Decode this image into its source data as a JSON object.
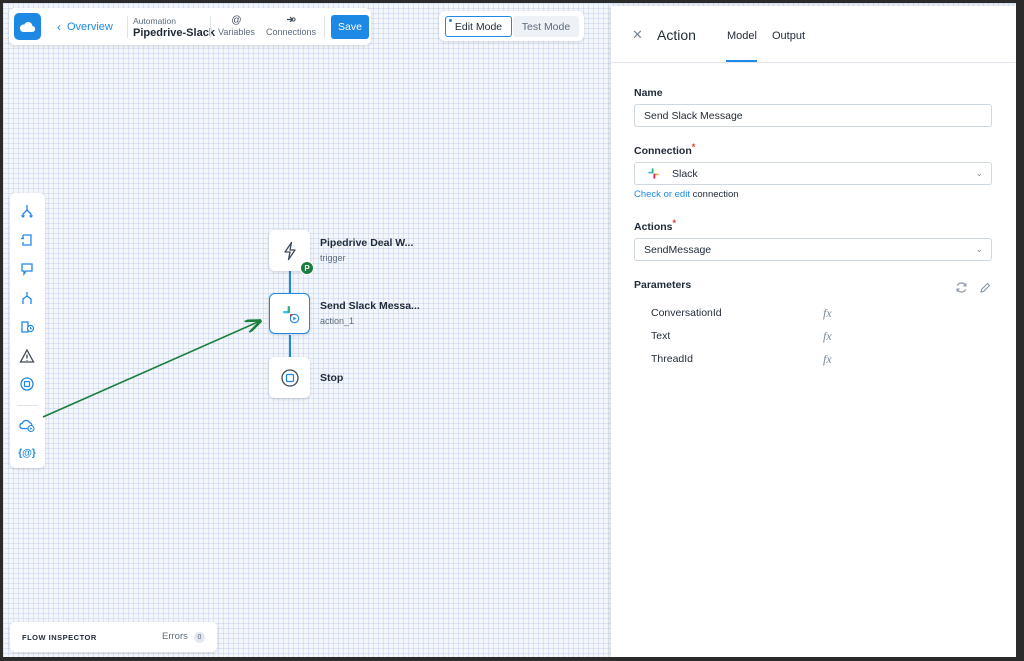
{
  "toolbar": {
    "back_label": "Overview",
    "automation_kicker": "Automation",
    "automation_name": "Pipedrive-Slack",
    "variables_label": "Variables",
    "connections_label": "Connections",
    "save_label": "Save"
  },
  "modes": {
    "edit": "Edit Mode",
    "test": "Test Mode"
  },
  "nodes": [
    {
      "title": "Pipedrive Deal W...",
      "subtitle": "trigger"
    },
    {
      "title": "Send Slack Messa...",
      "subtitle": "action_1"
    },
    {
      "title": "Stop"
    }
  ],
  "trigger_badge": "P",
  "palette": [
    "branch-icon",
    "loop-icon",
    "comment-icon",
    "parallel-icon",
    "delay-icon",
    "warning-icon",
    "stop-icon",
    "cloud-action-icon",
    "variable-icon"
  ],
  "variable_glyph": "{@}",
  "inspector": {
    "title": "FLOW INSPECTOR",
    "errors_label": "Errors",
    "errors_count": "0"
  },
  "panel": {
    "title": "Action",
    "tabs": [
      "Model",
      "Output"
    ],
    "active_tab": "Model",
    "name_label": "Name",
    "name_value": "Send Slack Message",
    "connection_label": "Connection",
    "connection_value": "Slack",
    "check_link": "Check or edit",
    "check_rest": " connection",
    "actions_label": "Actions",
    "actions_value": "SendMessage",
    "parameters_label": "Parameters",
    "parameters": [
      "ConversationId",
      "Text",
      "ThreadId"
    ],
    "fx_label": "fx"
  },
  "colors": {
    "accent": "#1e88e5",
    "arrow": "#1a7f3b",
    "required": "#e53935"
  }
}
